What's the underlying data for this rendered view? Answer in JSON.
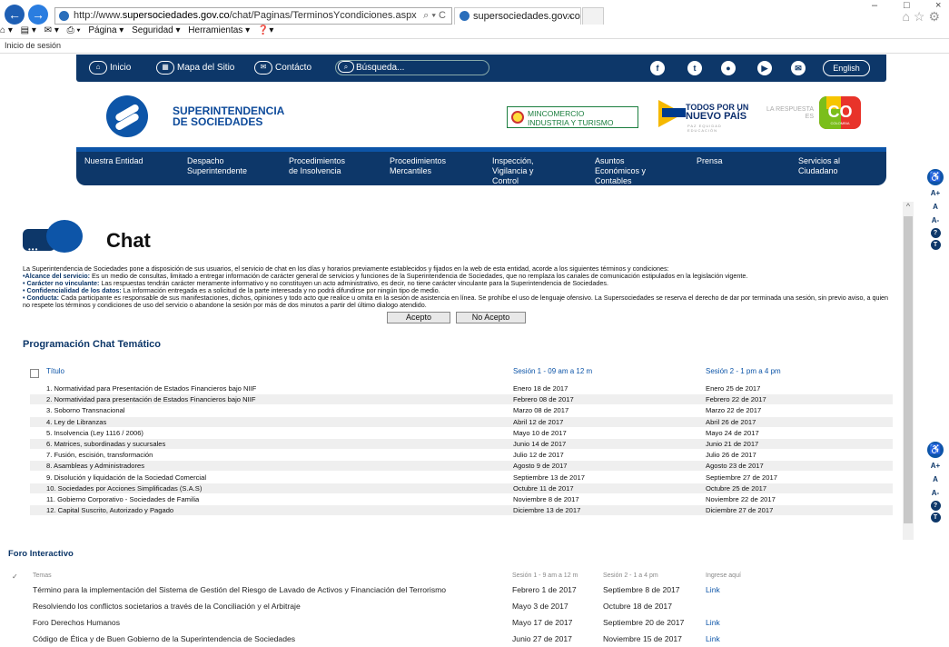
{
  "browser": {
    "url_prefix": "http://www.",
    "url_domain": "supersociedades.gov.co",
    "url_path": "/chat/Paginas/TerminosYcondiciones.aspx",
    "addr_controls": "⌕ ▾ C",
    "tab_title": "supersociedades.gov.co",
    "tab_close": "×",
    "menu": {
      "page": "Página ▾",
      "security": "Seguridad ▾",
      "tools": "Herramientas ▾"
    },
    "window_min": "–",
    "window_max": "□",
    "window_close": "×",
    "top_icons": "⌂☆⚙"
  },
  "login": "Inicio de sesión",
  "topnav": {
    "home": "Inicio",
    "sitemap": "Mapa del Sitio",
    "contact": "Contácto",
    "search_placeholder": "Búsqueda...",
    "english": "English",
    "social": [
      "f",
      "t",
      "●",
      "▶",
      "✉"
    ]
  },
  "header": {
    "site_name_1": "SUPERINTENDENCIA",
    "site_name_2": "DE SOCIEDADES",
    "mincom_1": "MINCOMERCIO",
    "mincom_2": "INDUSTRIA Y TURISMO",
    "todos_1": "TODOS POR UN",
    "todos_2": "NUEVO PAÍS",
    "todos_3": "PAZ EQUIDAD EDUCACIÓN",
    "respuesta": "LA RESPUESTA ES",
    "co": "CO",
    "colombia": "COLOMBIA"
  },
  "mainnav": [
    {
      "l1": "Nuestra Entidad",
      "l2": "",
      "l3": ""
    },
    {
      "l1": "Despacho",
      "l2": "Superintendente",
      "l3": ""
    },
    {
      "l1": "Procedimientos",
      "l2": "de Insolvencia",
      "l3": ""
    },
    {
      "l1": "Procedimientos",
      "l2": "Mercantiles",
      "l3": ""
    },
    {
      "l1": "Inspección,",
      "l2": "Vigilancia y",
      "l3": "Control"
    },
    {
      "l1": "Asuntos",
      "l2": "Económicos y",
      "l3": "Contables"
    },
    {
      "l1": "Prensa",
      "l2": "",
      "l3": ""
    },
    {
      "l1": "Servicios al",
      "l2": "Ciudadano",
      "l3": ""
    }
  ],
  "accessibility": [
    "♿",
    "A+",
    "A",
    "A-",
    "?",
    "T"
  ],
  "chat": {
    "title": "Chat",
    "intro": "La Superintendencia de Sociedades pone a disposición de sus usuarios, el servicio de chat en los días y horarios previamente establecidos y fijados en la web de esta entidad, acorde a los siguientes términos y condiciones:",
    "t1_label": "•Alcance del servicio:",
    "t1_text": " Es un medio de consultas, limitado a entregar información de carácter general de servicios y funciones de la Superintendencia de Sociedades, que no remplaza los canales de comunicación estipulados en la legislación vigente.",
    "t2_label": "• Carácter no vinculante:",
    "t2_text": " Las respuestas tendrán carácter meramente informativo y no constituyen un acto administrativo, es decir, no tiene carácter vinculante para la Superintendencia de Sociedades.",
    "t3_label": "• Confidencialidad de los datos:",
    "t3_text": " La información entregada es a solicitud de la parte interesada y no podrá difundirse por ningún tipo de medio.",
    "t4_label": "• Conducta:",
    "t4_text": " Cada participante es responsable de sus manifestaciones, dichos, opiniones y todo acto que realice u omita en la sesión de asistencia en línea. Se prohíbe el uso de lenguaje ofensivo. La Supersociedades se reserva el derecho de dar por terminada una sesión, sin previo aviso, a quien no respete los términos y condiciones de uso del servicio o abandone la sesión por más de dos minutos a partir del último dialogo atendido.",
    "accept": "Acepto",
    "reject": "No Acepto"
  },
  "programacion": {
    "title": "Programación Chat Temático",
    "headers": [
      "Título",
      "Sesión 1 - 09 am a 12 m",
      "Sesión 2 - 1 pm a 4 pm"
    ],
    "rows": [
      [
        "1. Normatividad para Presentación de Estados Financieros bajo NIIF",
        "Enero 18 de 2017",
        "Enero 25 de 2017"
      ],
      [
        "2. Normatividad para presentación de Estados Financieros bajo NIIF",
        "Febrero 08 de 2017",
        "Febrero 22 de 2017"
      ],
      [
        "3. Soborno Transnacional",
        "Marzo 08 de 2017",
        "Marzo 22 de 2017"
      ],
      [
        "4. Ley de Libranzas",
        "Abril 12 de 2017",
        "Abril 26 de 2017"
      ],
      [
        "5. Insolvencia (Ley 1116 / 2006)",
        "Mayo 10 de 2017",
        "Mayo 24 de 2017"
      ],
      [
        "6. Matrices, subordinadas y sucursales",
        "Junio 14 de 2017",
        "Junio 21 de 2017"
      ],
      [
        "7. Fusión, escisión, transformación",
        "Julio 12 de 2017",
        "Julio 26 de 2017"
      ],
      [
        "8. Asambleas y Administradores",
        "Agosto 9 de 2017",
        "Agosto 23 de 2017"
      ],
      [
        "9. Disolución y liquidación de la Sociedad Comercial",
        "Septiembre 13 de 2017",
        "Septiembre 27 de 2017"
      ],
      [
        "10. Sociedades por Acciones Simplificadas (S.A.S)",
        "Octubre 11 de 2017",
        "Octubre 25 de 2017"
      ],
      [
        "11. Gobierno Corporativo - Sociedades de Familia",
        "Noviembre 8 de 2017",
        "Noviembre 22 de 2017"
      ],
      [
        "12. Capital Suscrito, Autorizado y Pagado",
        "Diciembre 13 de 2017",
        "Diciembre 27 de 2017"
      ]
    ]
  },
  "foro": {
    "title": "Foro Interactivo",
    "check": "✓",
    "headers": [
      "Temas",
      "Sesión 1 - 9 am a 12 m",
      "Sesión 2 - 1 a 4 pm",
      "Ingrese aquí"
    ],
    "rows": [
      [
        "Término para la implementación del Sistema de Gestión del Riesgo de Lavado de Activos y Financiación del Terrorismo",
        "Febrero 1 de 2017",
        "Septiembre 8 de 2017",
        "Link"
      ],
      [
        "Resolviendo los conflictos societarios a través de la Conciliación y el Arbitraje",
        "Mayo 3 de 2017",
        "Octubre 18 de 2017",
        ""
      ],
      [
        "Foro Derechos Humanos",
        "Mayo 17 de 2017",
        "Septiembre 20 de 2017",
        "Link"
      ],
      [
        "Código de Ética y de Buen Gobierno de la Superintendencia de Sociedades",
        "Junio 27 de 2017",
        "Noviembre 15 de 2017",
        "Link"
      ]
    ]
  }
}
